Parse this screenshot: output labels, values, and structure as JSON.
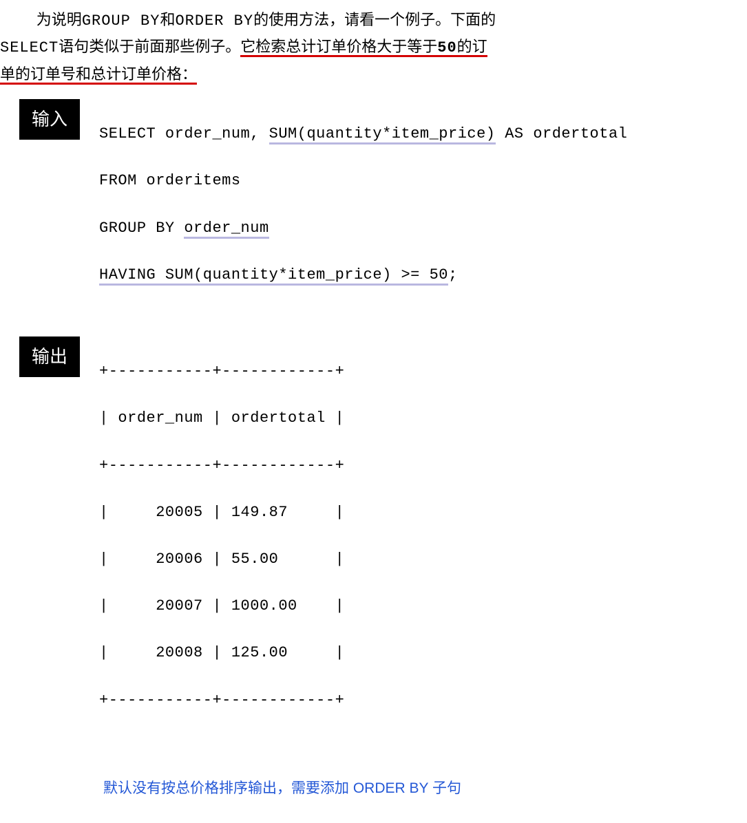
{
  "para": {
    "t1a": "为说明",
    "t1b": "GROUP BY",
    "t1c": "和",
    "t1d": "ORDER BY",
    "t1e": "的使用方法，请看一个例子。下面的",
    "t2a": "SELECT",
    "t2b": "语句类似于前面那些例子。",
    "t2c": "它检索总计订单价格大于等于50的订",
    "t3a": "单的订单号和总计订单价格：",
    "bold50": "50"
  },
  "labels": {
    "input": "输入",
    "output": "输出"
  },
  "input_code": {
    "l1a": "SELECT order_num, ",
    "l1b": "SUM(quantity*item_price)",
    "l1c": " AS ordertotal",
    "l2": "FROM orderitems",
    "l3a": "GROUP BY ",
    "l3b": "order_num",
    "l4a": "HAVING SUM(quantity*item_price) >= 50",
    "l4b": ";"
  },
  "output_table": {
    "sep": "+-----------+------------+",
    "hdr": "| order_num | ordertotal |",
    "r1": "|     20005 | 149.87     |",
    "r2": "|     20006 | 55.00      |",
    "r3": "|     20007 | 1000.00    |",
    "r4": "|     20008 | 125.00     |"
  },
  "footer": "默认没有按总价格排序输出，需要添加 ORDER BY 子句"
}
